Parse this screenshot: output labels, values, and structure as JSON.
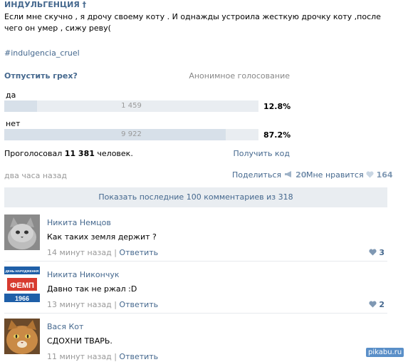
{
  "post": {
    "title": "ИНДУЛЬГЕНЦИЯ †",
    "text": "Если мне скучно , я дрочу своему коту . И однажды устроила жесткую дрочку коту ,после чего он умер , сижу реву(",
    "hashtag": "#indulgencia_cruel",
    "date": "два часа назад",
    "share_label": "Поделиться",
    "share_count": "20",
    "like_label": "Мне нравится",
    "like_count": "164"
  },
  "poll": {
    "question": "Отпустить грех?",
    "type": "Анонимное голосование",
    "options": [
      {
        "label": "да",
        "count": "1 459",
        "percent": "12.8%",
        "fraction": 0.128
      },
      {
        "label": "нет",
        "count": "9 922",
        "percent": "87.2%",
        "fraction": 0.872
      }
    ],
    "voted_prefix": "Проголосовал",
    "voted_count": "11 381",
    "voted_suffix": "человек.",
    "get_code": "Получить код"
  },
  "comments_bar": {
    "label": "Показать последние 100 комментариев из 318"
  },
  "comments": [
    {
      "author": "Никита Немцов",
      "text": "Как таких земля держит ?",
      "time": "14 минут назад",
      "reply": "Ответить",
      "likes": "3"
    },
    {
      "author": "Никита Никончук",
      "text": "Давно так не ржал :D",
      "time": "13 минут назад",
      "reply": "Ответить",
      "likes": "2"
    },
    {
      "author": "Вася Кот",
      "text": "СДОХНИ ТВАРЬ.",
      "time": "11 минут назад",
      "reply": "Ответить",
      "likes": "1"
    }
  ],
  "avatar2_text": {
    "top": "ДЕНЬ НАРОДЖЕННЯ",
    "mid": "ФЕМП",
    "bottom": "1966"
  },
  "watermark": "pikabu.ru",
  "colors": {
    "link": "#45688e",
    "bar": "#d7e0e9",
    "bar_bg": "#e9edf1"
  }
}
